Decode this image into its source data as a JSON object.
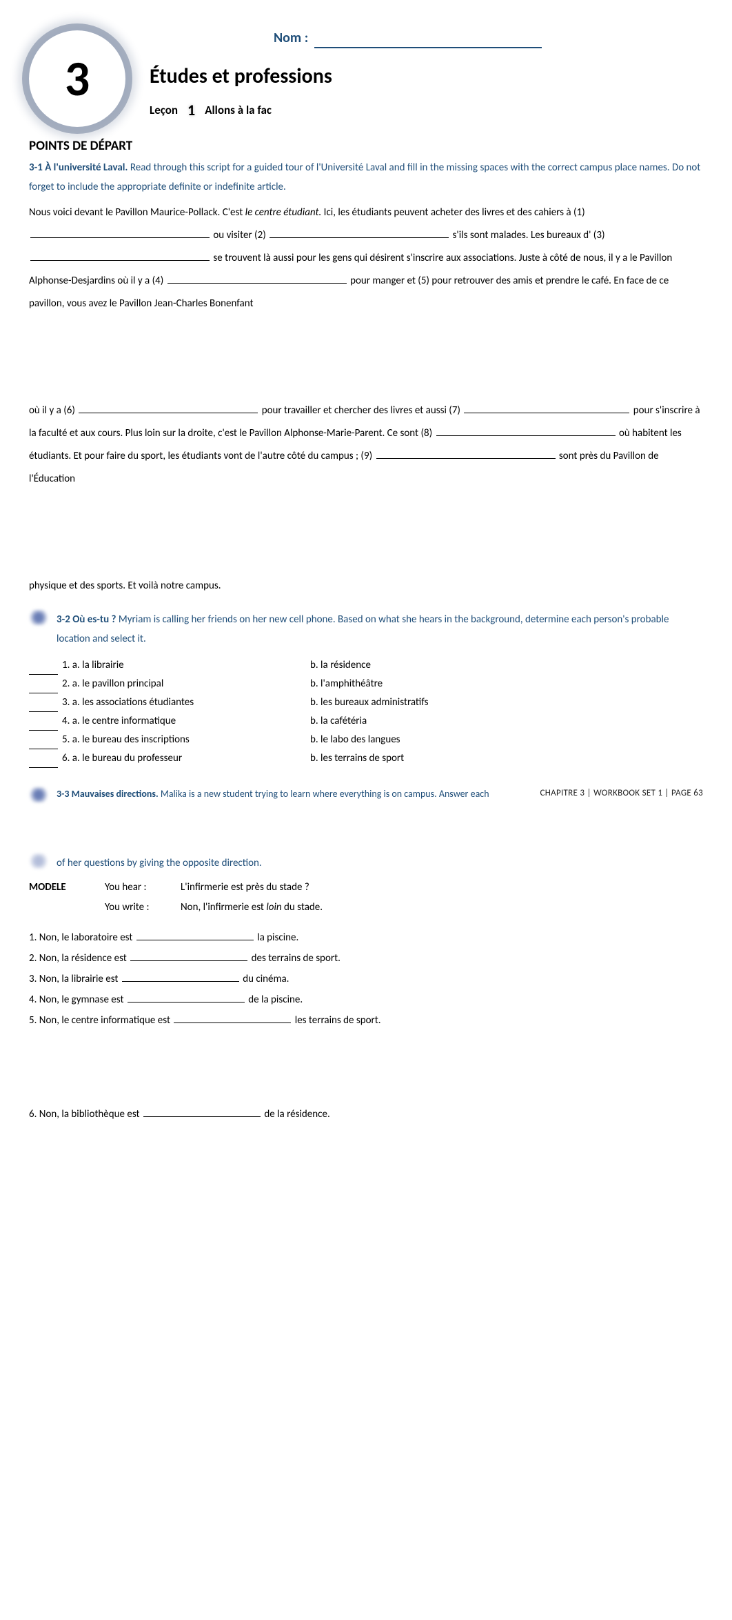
{
  "header": {
    "nom_label": "Nom :",
    "chapter_number": "3",
    "chapter_title": "Études et professions",
    "lecon_label": "Leçon",
    "lecon_number": "1",
    "lecon_title": "Allons à la fac"
  },
  "points_depart": "POINTS DE DÉPART",
  "ex31": {
    "title": "3-1 À l'université Laval.",
    "desc": "Read through this script for a guided tour of l'Université Laval and fill in the missing spaces with the correct campus place names. Do not forget to include the appropriate definite or indefinite article.",
    "p1a": "Nous voici devant le Pavillon Maurice-Pollack. C'est ",
    "p1b_italic": "le centre étudiant.",
    "p1c": " Ici, les étudiants peuvent acheter des livres et des cahiers à (1) ",
    "p1d": " ou visiter (2) ",
    "p1e": " s'ils sont malades. Les bureaux d' (3) ",
    "p1f": " se trouvent là aussi pour les gens qui désirent s'inscrire aux associations. Juste à côté de nous, il y a le Pavillon Alphonse-Desjardins où il y a (4) ",
    "p1g": " pour manger et (5) pour retrouver des amis et prendre le café. En face de ce pavillon, vous avez le Pavillon Jean-Charles Bonenfant",
    "p2a": "où il y a (6) ",
    "p2b": " pour travailler et chercher des livres et aussi (7) ",
    "p2c": " pour s'inscrire à la faculté et aux cours. Plus loin sur la droite, c'est le Pavillon Alphonse-Marie-Parent. Ce sont (8) ",
    "p2d": " où habitent les étudiants. Et pour faire du sport, les étudiants vont de l'autre côté du campus ; (9) ",
    "p2e": " sont près du Pavillon de l'Éducation",
    "p3": "physique et des sports. Et voilà notre campus."
  },
  "ex32": {
    "title": "3-2 Où es-tu ?",
    "desc": "Myriam is calling her friends on her new cell phone. Based on what she hears in the background, determine each person's probable location and select it.",
    "items": [
      {
        "a": "1. a. la librairie",
        "b": "b. la résidence"
      },
      {
        "a": "2. a. le pavillon principal",
        "b": "b. l'amphithéâtre"
      },
      {
        "a": "3. a. les associations étudiantes",
        "b": "b. les bureaux administratifs"
      },
      {
        "a": "4. a. le centre informatique",
        "b": "b. la cafétéria"
      },
      {
        "a": "5. a. le bureau des inscriptions",
        "b": "b. le labo des langues"
      },
      {
        "a": "6. a. le bureau du professeur",
        "b": "b. les terrains de sport"
      }
    ]
  },
  "ex33": {
    "title": "3-3 Mauvaises directions.",
    "desc_part1": "Malika is a new student trying to learn where everything is on campus. Answer each",
    "footer_overlay": "CHAPITRE 3 | WORKBOOK SET 1 | PAGE 63",
    "desc_part2": "of her questions by giving the opposite direction.",
    "modele_label": "MODELE",
    "modele_hear_label": "You hear :",
    "modele_hear_text": "L'infirmerie est près du stade ?",
    "modele_write_label": "You write :",
    "modele_write_pre": "Non, l'infirmerie est ",
    "modele_write_italic": "loin",
    "modele_write_post": " du stade.",
    "fills": [
      {
        "pre": "1. Non, le laboratoire est ",
        "post": " la piscine."
      },
      {
        "pre": "2. Non, la résidence est ",
        "post": " des terrains de sport."
      },
      {
        "pre": "3. Non, la librairie est ",
        "post": " du cinéma."
      },
      {
        "pre": "4. Non, le gymnase est ",
        "post": " de la piscine."
      },
      {
        "pre": "5. Non, le centre informatique est ",
        "post": " les terrains de sport."
      }
    ],
    "fill6_pre": "6. Non, la bibliothèque est ",
    "fill6_post": " de la résidence."
  }
}
